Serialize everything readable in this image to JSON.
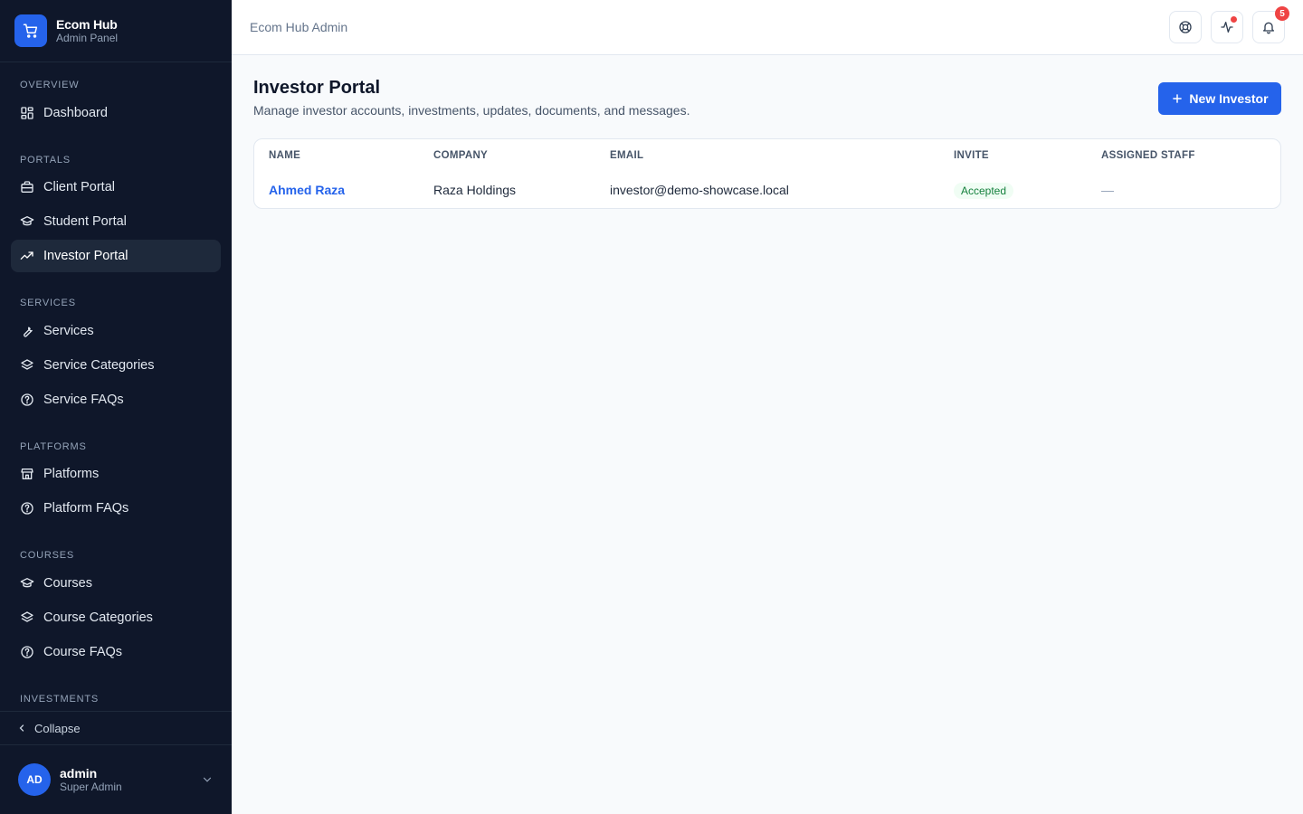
{
  "brand": {
    "name": "Ecom Hub",
    "subtitle": "Admin Panel"
  },
  "sidebar": {
    "sections": [
      {
        "label": "OVERVIEW"
      },
      {
        "label": "PORTALS"
      },
      {
        "label": "SERVICES"
      },
      {
        "label": "PLATFORMS"
      },
      {
        "label": "COURSES"
      },
      {
        "label": "INVESTMENTS"
      }
    ],
    "items": [
      {
        "label": "Dashboard",
        "icon": "dashboard-icon"
      },
      {
        "label": "Client Portal",
        "icon": "briefcase-icon"
      },
      {
        "label": "Student Portal",
        "icon": "graduation-cap-icon"
      },
      {
        "label": "Investor Portal",
        "icon": "trending-up-icon",
        "active": true
      },
      {
        "label": "Services",
        "icon": "wrench-icon"
      },
      {
        "label": "Service Categories",
        "icon": "layers-icon"
      },
      {
        "label": "Service FAQs",
        "icon": "help-circle-icon"
      },
      {
        "label": "Platforms",
        "icon": "store-icon"
      },
      {
        "label": "Platform FAQs",
        "icon": "help-circle-icon"
      },
      {
        "label": "Courses",
        "icon": "graduation-cap-icon"
      },
      {
        "label": "Course Categories",
        "icon": "layers-icon"
      },
      {
        "label": "Course FAQs",
        "icon": "help-circle-icon"
      }
    ],
    "collapse_label": "Collapse"
  },
  "user": {
    "initials": "AD",
    "name": "admin",
    "role": "Super Admin"
  },
  "topbar": {
    "title": "Ecom Hub Admin",
    "notification_count": "5"
  },
  "main": {
    "title": "Investor Portal",
    "subtitle": "Manage investor accounts, investments, updates, documents, and messages.",
    "new_button_label": "New Investor"
  },
  "table": {
    "columns": [
      "NAME",
      "COMPANY",
      "EMAIL",
      "INVITE",
      "ASSIGNED STAFF"
    ],
    "rows": [
      {
        "name": "Ahmed Raza",
        "company": "Raza Holdings",
        "email": "investor@demo-showcase.local",
        "invite": "Accepted",
        "assigned_staff": "—"
      }
    ]
  },
  "colors": {
    "sidebar_bg": "#0f172a",
    "accent": "#2563eb",
    "success": "#15803d",
    "danger": "#ef4444"
  }
}
